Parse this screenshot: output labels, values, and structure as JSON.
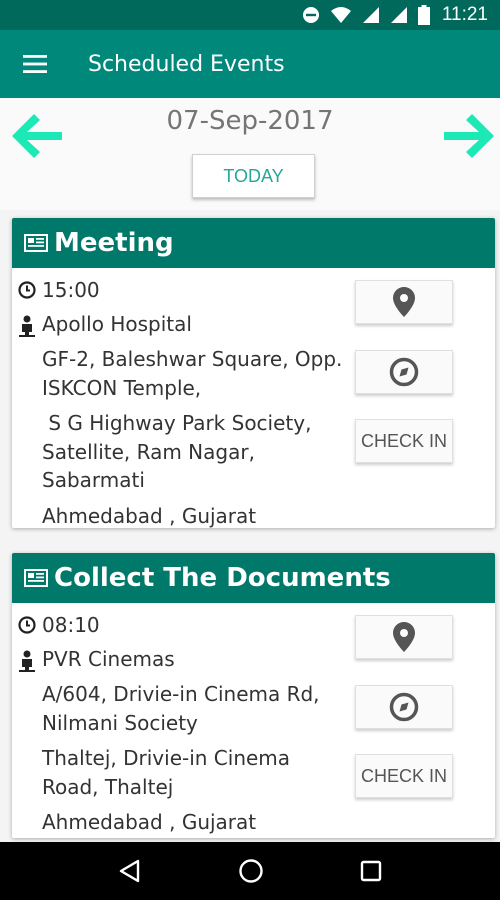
{
  "status_bar": {
    "time": "11:21"
  },
  "app_bar": {
    "title": "Scheduled Events"
  },
  "date_nav": {
    "date": "07-Sep-2017",
    "today_label": "TODAY"
  },
  "events": [
    {
      "title": "Meeting",
      "time": "15:00",
      "place": "Apollo Hospital",
      "address_1": "GF-2, Baleshwar Square, Opp. ISKCON Temple,",
      "address_2": " S G Highway Park Society, Satellite, Ram Nagar, Sabarmati",
      "city": "Ahmedabad , Gujarat",
      "check_in_label": "CHECK IN"
    },
    {
      "title": "Collect The Documents",
      "time": "08:10",
      "place": "PVR Cinemas",
      "address_1": "A/604, Drivie-in Cinema Rd, Nilmani Society",
      "address_2": "Thaltej, Drivie-in Cinema Road, Thaltej",
      "city": "Ahmedabad , Gujarat",
      "check_in_label": "CHECK IN"
    }
  ],
  "colors": {
    "primary": "#00897b",
    "primary_dark": "#00695c",
    "card_header": "#00796b",
    "accent": "#26a69a"
  },
  "icons": [
    "menu-icon",
    "arrow-left-icon",
    "arrow-right-icon",
    "newspaper-icon",
    "clock-icon",
    "person-icon",
    "location-pin-icon",
    "compass-icon",
    "back-icon",
    "home-icon",
    "recents-icon"
  ]
}
